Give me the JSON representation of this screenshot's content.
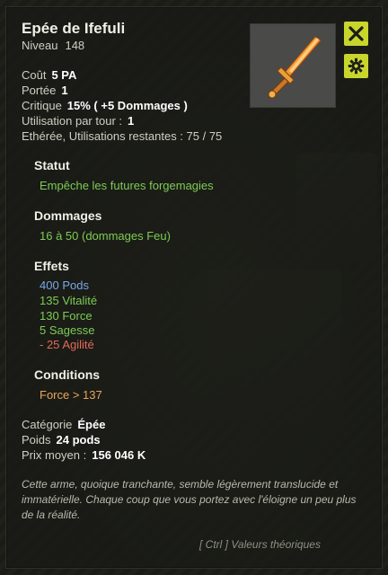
{
  "item": {
    "name": "Epée de Ifefuli",
    "level_label": "Niveau",
    "level": "148"
  },
  "icons": {
    "close": "close-icon",
    "settings": "gear-icon",
    "item": "sword-icon"
  },
  "colors": {
    "accent_button": "#c8d62c",
    "green": "#7dcc55",
    "blue": "#7aa8e8",
    "red": "#e36a5a",
    "orange": "#e9a45a"
  },
  "stats": {
    "cout_label": "Coût",
    "cout_value": "5 PA",
    "portee_label": "Portée",
    "portee_value": "1",
    "critique_label": "Critique",
    "critique_value": "15% ( +5 Dommages )",
    "usage_label": "Utilisation par tour :",
    "usage_value": "1",
    "ethere": "Ethérée, Utilisations restantes : 75 / 75"
  },
  "statut": {
    "title": "Statut",
    "text": "Empêche les futures forgemagies"
  },
  "dommages": {
    "title": "Dommages",
    "text": "16 à 50 (dommages Feu)"
  },
  "effets": {
    "title": "Effets",
    "items": [
      {
        "value": "400",
        "label": "Pods"
      },
      {
        "value": "135",
        "label": "Vitalité"
      },
      {
        "value": "130",
        "label": "Force"
      },
      {
        "value": "5",
        "label": "Sagesse"
      },
      {
        "value": "- 25",
        "label": "Agilité"
      }
    ]
  },
  "conditions": {
    "title": "Conditions",
    "text": "Force > 137"
  },
  "info": {
    "categorie_label": "Catégorie",
    "categorie_value": "Épée",
    "poids_label": "Poids",
    "poids_value": "24 pods",
    "prix_label": "Prix moyen :",
    "prix_value": "156 046 K"
  },
  "description": "Cette arme, quoique tranchante, semble légèrement translucide et immatérielle. Chaque coup que vous portez avec l'éloigne un peu plus de la réalité.",
  "ctrl_hint": "[ Ctrl ] Valeurs théoriques"
}
